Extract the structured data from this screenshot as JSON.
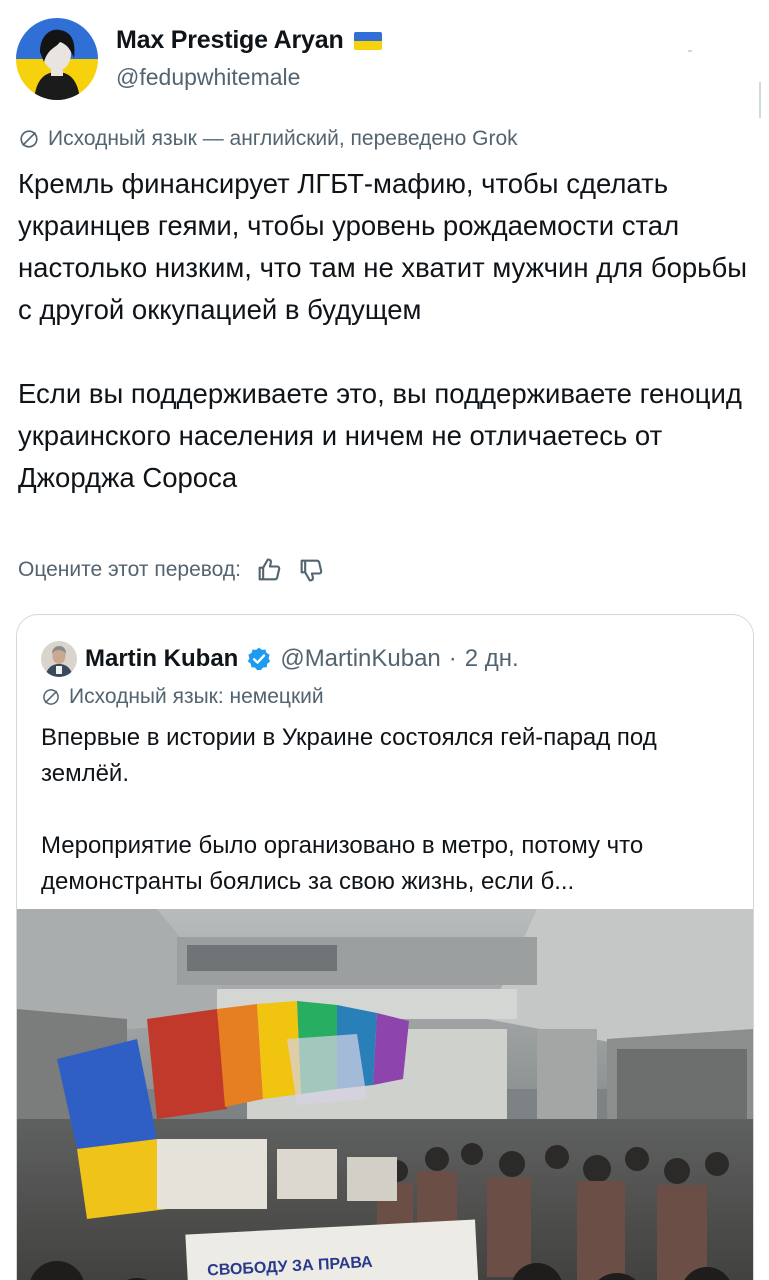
{
  "author": {
    "display_name": "Max Prestige Aryan",
    "handle": "@fedupwhitemale",
    "flag_icon": "ukraine-flag-icon",
    "flag_colors": [
      "#2f6fd6",
      "#f5d20b"
    ]
  },
  "translation_note": "Исходный язык — английский, переведено Grok",
  "post_text": {
    "paragraph_1": "Кремль финансирует ЛГБТ-мафию, чтобы сделать украинцев геями, чтобы уровень рождаемости стал настолько низким, что там не хватит мужчин для борьбы с другой оккупацией в будущем",
    "paragraph_2": "Если вы поддерживаете это, вы поддерживаете геноцид украинского населения и ничем не отличаетесь от Джорджа Сороса"
  },
  "rate_translation": {
    "label": "Оцените этот перевод:",
    "like_icon": "thumbs-up-icon",
    "dislike_icon": "thumbs-down-icon"
  },
  "quoted_post": {
    "display_name": "Martin Kuban",
    "verified_icon": "verified-badge-icon",
    "handle": "@MartinKuban",
    "separator": "·",
    "date": "2 дн.",
    "translation_note": "Исходный язык: немецкий",
    "paragraph_1": "Впервые в истории в Украине состоялся гей-парад под землёй.",
    "paragraph_2": "Мероприятие было организовано в метро, потому что демонстранты боялись за свою жизнь, если б...",
    "media_banner_text": "СВОБОДУ ЗА ПРАВА"
  },
  "colors": {
    "text_primary": "#0f1419",
    "text_secondary": "#536471",
    "border": "#cfd9de",
    "verified": "#1d9bf0"
  }
}
